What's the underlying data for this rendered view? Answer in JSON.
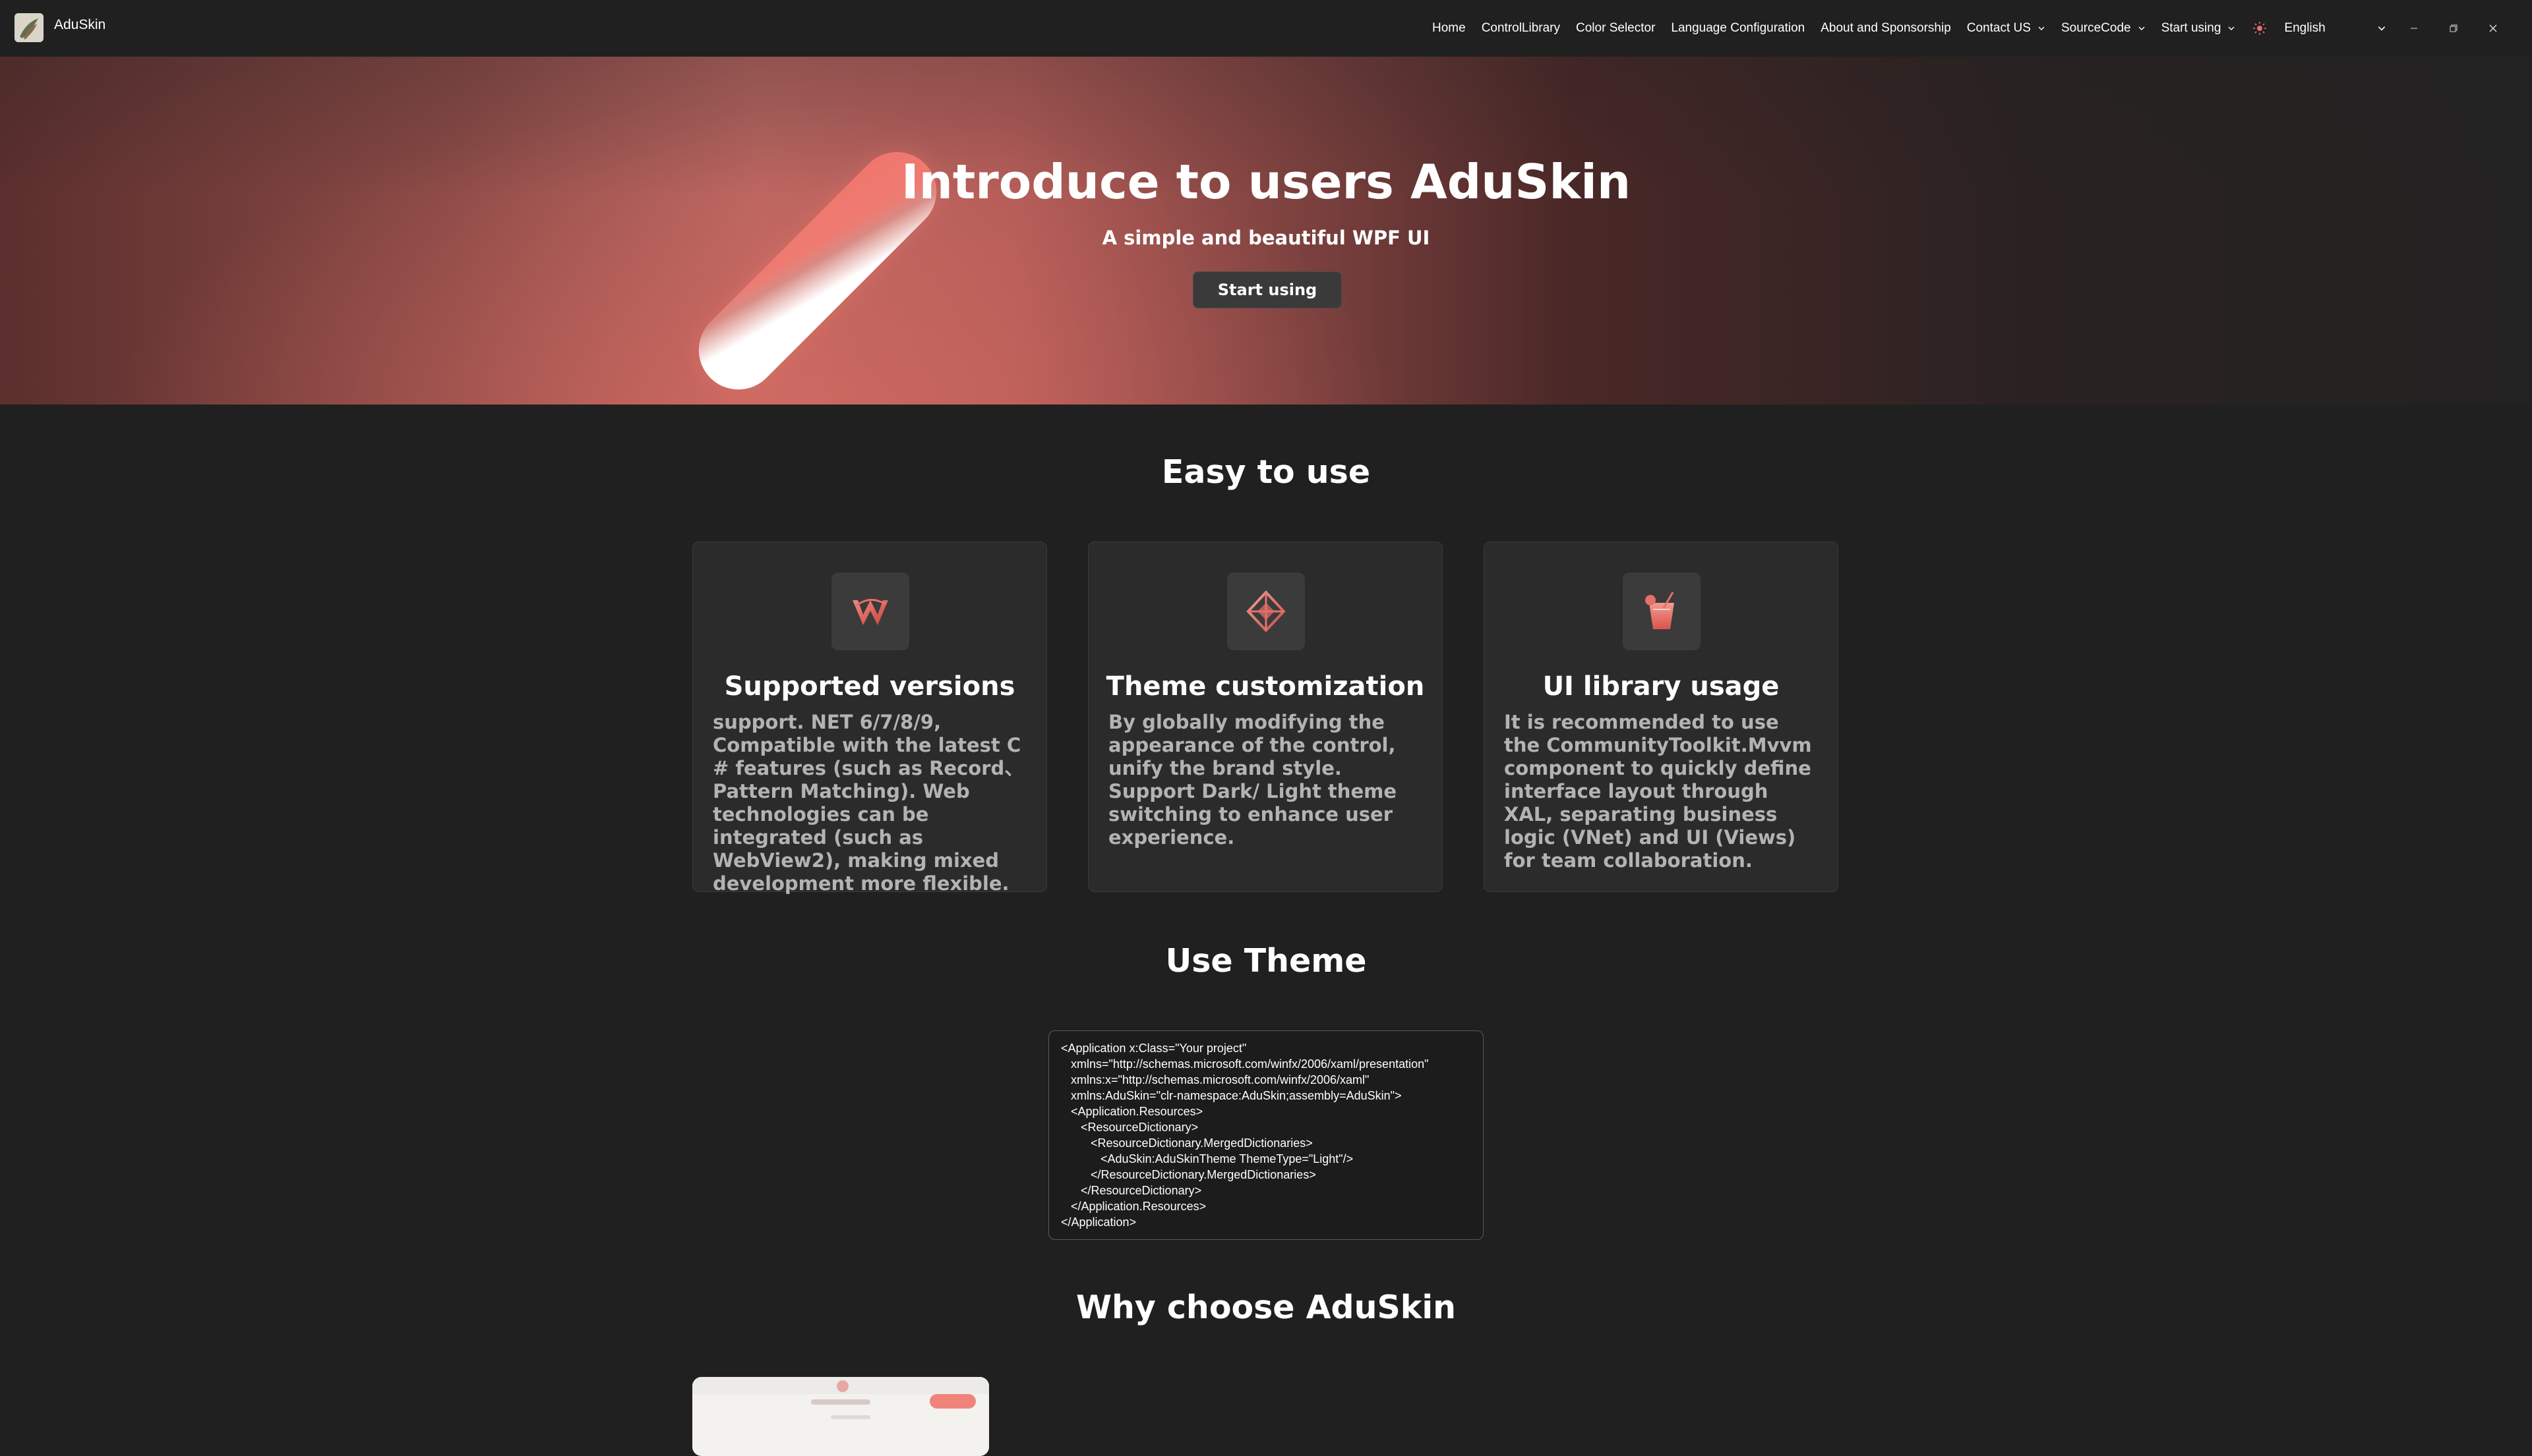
{
  "app": {
    "title": "AduSkin"
  },
  "nav": {
    "items": [
      {
        "label": "Home",
        "has_dropdown": false
      },
      {
        "label": "ControlLibrary",
        "has_dropdown": false
      },
      {
        "label": "Color Selector",
        "has_dropdown": false
      },
      {
        "label": "Language Configuration",
        "has_dropdown": false
      },
      {
        "label": "About and Sponsorship",
        "has_dropdown": false
      },
      {
        "label": "Contact US",
        "has_dropdown": true
      },
      {
        "label": "SourceCode",
        "has_dropdown": true
      },
      {
        "label": "Start using",
        "has_dropdown": true
      }
    ],
    "theme_icon": "sun-icon",
    "language": "English"
  },
  "window_controls": [
    "minimize-icon",
    "restore-icon",
    "close-icon"
  ],
  "hero": {
    "title": "Introduce to users AduSkin",
    "subtitle": "A simple and beautiful WPF UI",
    "button": "Start using"
  },
  "easy": {
    "title": "Easy to use",
    "cards": [
      {
        "icon": "office-w-icon",
        "title": "Supported versions",
        "body": "support. NET 6/7/8/9, Compatible with the latest C # features (such as Record、Pattern Matching). Web technologies can be integrated (such as WebView2), making mixed development more flexible."
      },
      {
        "icon": "diamond-compass-icon",
        "title": "Theme customization",
        "body": "By globally modifying the appearance of the control, unify the brand style. Support Dark/ Light theme switching to enhance user experience."
      },
      {
        "icon": "drink-cup-icon",
        "title": "UI library usage",
        "body": "It is recommended to use the CommunityToolkit.Mvvm component to quickly define interface layout through XAL, separating business logic (VNet) and UI (Views) for team collaboration."
      }
    ]
  },
  "theme": {
    "title": "Use Theme",
    "code": "<Application x:Class=\"Your project\"\n   xmlns=\"http://schemas.microsoft.com/winfx/2006/xaml/presentation\"\n   xmlns:x=\"http://schemas.microsoft.com/winfx/2006/xaml\"\n   xmlns:AduSkin=\"clr-namespace:AduSkin;assembly=AduSkin\">\n   <Application.Resources>\n      <ResourceDictionary>\n         <ResourceDictionary.MergedDictionaries>\n            <AduSkin:AduSkinTheme ThemeType=\"Light\"/>\n         </ResourceDictionary.MergedDictionaries>\n      </ResourceDictionary>\n   </Application.Resources>\n</Application>"
  },
  "why": {
    "title": "Why choose AduSkin"
  },
  "colors": {
    "background": "#202020",
    "card": "#2b2b2b",
    "accent": "#e8706a"
  }
}
